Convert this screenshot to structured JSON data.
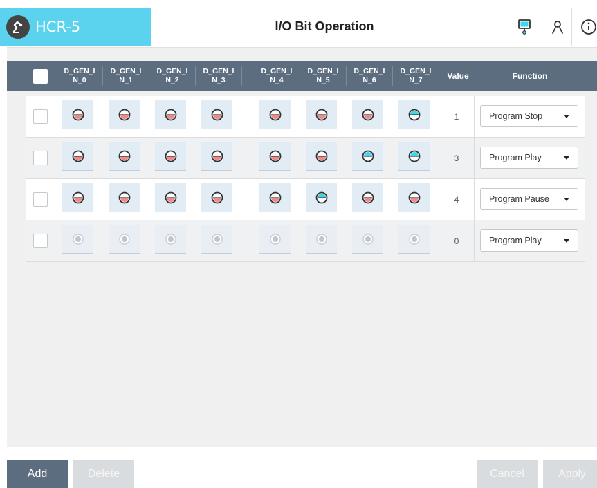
{
  "app": {
    "name": "HCR-5",
    "title": "I/O Bit Operation",
    "colors": {
      "accent": "#5bd3ee",
      "header_bar": "#5d6d80",
      "bit_off": "#f08a8a",
      "bit_on": "#3dd6ec"
    }
  },
  "header_icons": [
    "monitor-icon",
    "user-icon",
    "info-icon"
  ],
  "table": {
    "columns": [
      "D_GEN_I\nN_0",
      "D_GEN_I\nN_1",
      "D_GEN_I\nN_2",
      "D_GEN_I\nN_3",
      "D_GEN_I\nN_4",
      "D_GEN_I\nN_5",
      "D_GEN_I\nN_6",
      "D_GEN_I\nN_7"
    ],
    "value_header": "Value",
    "function_header": "Function",
    "rows": [
      {
        "bits": [
          0,
          0,
          0,
          0,
          0,
          0,
          0,
          1
        ],
        "value": "1",
        "function": "Program Stop",
        "enabled": true
      },
      {
        "bits": [
          0,
          0,
          0,
          0,
          0,
          0,
          1,
          1
        ],
        "value": "3",
        "function": "Program Play",
        "enabled": true
      },
      {
        "bits": [
          0,
          0,
          0,
          0,
          0,
          1,
          0,
          0
        ],
        "value": "4",
        "function": "Program Pause",
        "enabled": true
      },
      {
        "bits": [
          0,
          0,
          0,
          0,
          0,
          0,
          0,
          0
        ],
        "value": "0",
        "function": "Program Play",
        "enabled": false
      }
    ]
  },
  "footer": {
    "add": "Add",
    "delete": "Delete",
    "cancel": "Cancel",
    "apply": "Apply"
  }
}
